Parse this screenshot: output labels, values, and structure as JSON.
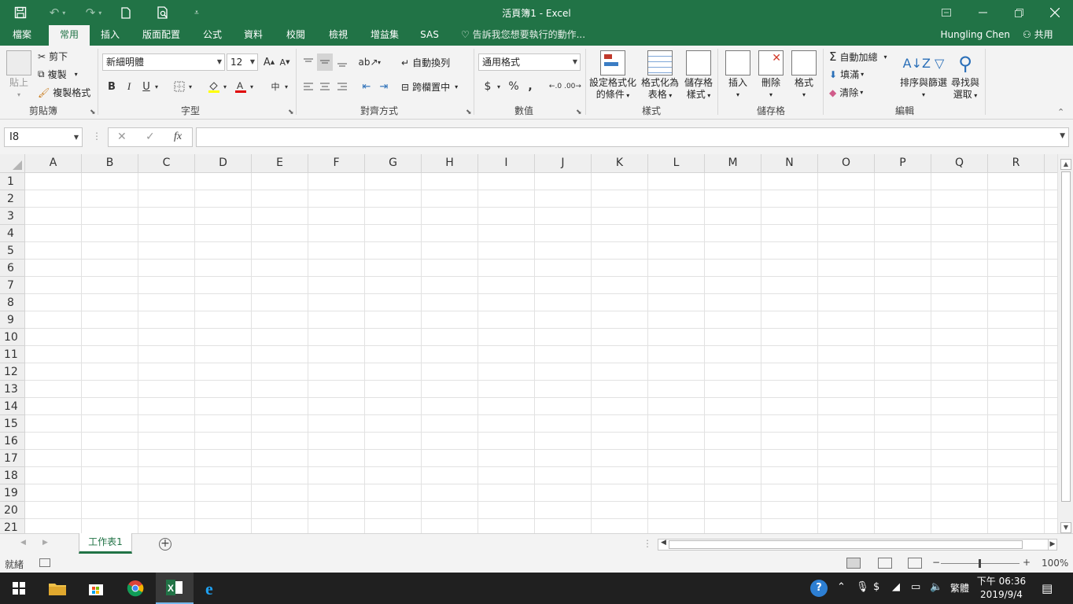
{
  "window": {
    "title": "活頁簿1 - Excel",
    "accent_color": "#217346"
  },
  "quick_access": {
    "save_icon": "save-icon",
    "undo_icon": "undo-icon",
    "redo_icon": "redo-icon",
    "new_icon": "new-document-icon",
    "print_preview_icon": "print-preview-icon",
    "customize_icon": "customize-quick-access-icon"
  },
  "tabs": [
    "檔案",
    "常用",
    "插入",
    "版面配置",
    "公式",
    "資料",
    "校閱",
    "檢視",
    "增益集",
    "SAS"
  ],
  "active_tab": "常用",
  "tell_me": "告訴我您想要執行的動作...",
  "user": "Hungling Chen",
  "share": "共用",
  "ribbon": {
    "clipboard": {
      "paste": "貼上",
      "cut": "剪下",
      "copy": "複製",
      "format_painter": "複製格式",
      "label": "剪貼簿"
    },
    "font": {
      "name": "新細明體",
      "size": "12",
      "bold": "B",
      "italic": "I",
      "underline": "U",
      "label": "字型"
    },
    "alignment": {
      "wrap_text": "自動換列",
      "merge_center": "跨欄置中",
      "label": "對齊方式"
    },
    "number": {
      "format": "通用格式",
      "currency": "$",
      "percent": "%",
      "comma": ",",
      "label": "數值"
    },
    "styles": {
      "conditional_line1": "設定格式化",
      "conditional_line2": "的條件",
      "table_line1": "格式化為",
      "table_line2": "表格",
      "cell_styles_line1": "儲存格",
      "cell_styles_line2": "樣式",
      "label": "樣式"
    },
    "cells": {
      "insert": "插入",
      "delete": "刪除",
      "format": "格式",
      "label": "儲存格"
    },
    "editing": {
      "autosum": "自動加總",
      "fill": "填滿",
      "clear": "清除",
      "sort_line1": "排序與篩選",
      "find_line1": "尋找與",
      "find_line2": "選取",
      "label": "編輯"
    }
  },
  "formula_bar": {
    "name_box": "I8",
    "fx": "fx",
    "content": ""
  },
  "grid": {
    "columns": [
      "A",
      "B",
      "C",
      "D",
      "E",
      "F",
      "G",
      "H",
      "I",
      "J",
      "K",
      "L",
      "M",
      "N",
      "O",
      "P",
      "Q",
      "R"
    ],
    "rows": [
      "1",
      "2",
      "3",
      "4",
      "5",
      "6",
      "7",
      "8",
      "9",
      "10",
      "11",
      "12",
      "13",
      "14",
      "15",
      "16",
      "17",
      "18",
      "19",
      "20",
      "21"
    ]
  },
  "sheets": [
    "工作表1"
  ],
  "status": {
    "ready": "就緒",
    "zoom": "100%",
    "zoom_minus": "−",
    "zoom_plus": "+"
  },
  "taskbar": {
    "ime": "繁體",
    "time": "下午 06:36",
    "date": "2019/9/4"
  }
}
